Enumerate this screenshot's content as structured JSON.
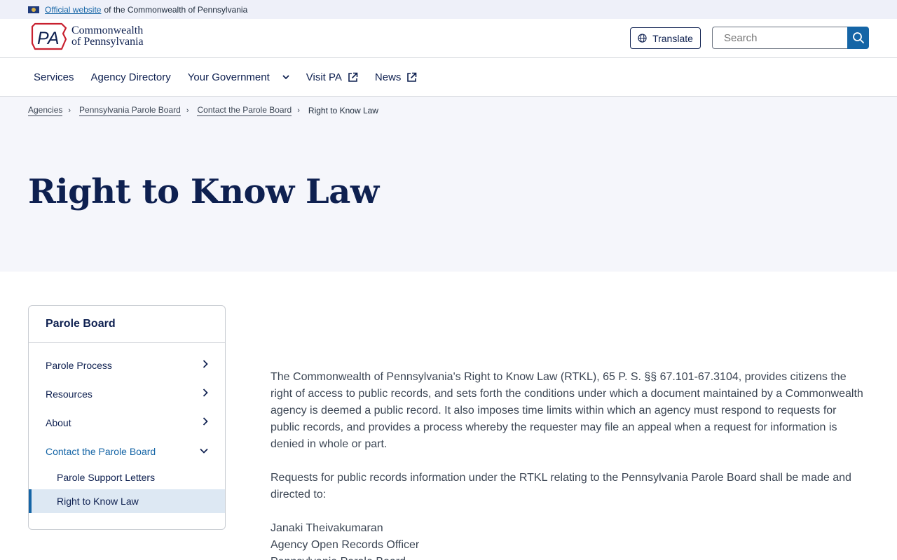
{
  "banner": {
    "link_text": "Official website",
    "rest_text": "of the Commonwealth of Pennsylvania"
  },
  "header": {
    "logo_mark_text": "PA",
    "logo_line1": "Commonwealth",
    "logo_line2": "of Pennsylvania",
    "translate_label": "Translate",
    "search_placeholder": "Search"
  },
  "nav": {
    "items": [
      {
        "label": "Services"
      },
      {
        "label": "Agency Directory"
      },
      {
        "label": "Your Government"
      },
      {
        "label": "Visit PA"
      },
      {
        "label": "News"
      }
    ]
  },
  "breadcrumb": {
    "items": [
      "Agencies",
      "Pennsylvania Parole Board",
      "Contact the Parole Board"
    ],
    "current": "Right to Know Law"
  },
  "page_title": "Right to Know Law",
  "sidenav": {
    "title": "Parole Board",
    "items": [
      {
        "label": "Parole Process"
      },
      {
        "label": "Resources"
      },
      {
        "label": "About"
      },
      {
        "label": "Contact the Parole Board"
      }
    ],
    "subitems": [
      {
        "label": "Parole Support Letters"
      },
      {
        "label": "Right to Know Law"
      }
    ]
  },
  "content": {
    "paragraph1": "The Commonwealth of Pennsylvania's Right to Know Law (RTKL), 65 P. S. §§ 67.101-67.3104, provides citizens the right of access to public records, and sets forth the conditions under which a document maintained by a Commonwealth agency is deemed a public record. It also imposes time limits within which an agency must respond to requests for public records, and provides a process whereby the requester may file an appeal when a request for information is denied in whole or part.",
    "paragraph2": "Requests for public records information under the RTKL relating to the Pennsylvania Parole Board shall be made and directed to:",
    "contact_name": "Janaki Theivakumaran",
    "contact_title": "Agency Open Records Officer",
    "contact_org": "Pennsylvania Parole Board"
  },
  "colors": {
    "navy": "#0e2050",
    "link_blue": "#1565a6",
    "logo_red": "#c8202f",
    "hero_bg": "#f5f6fb"
  }
}
